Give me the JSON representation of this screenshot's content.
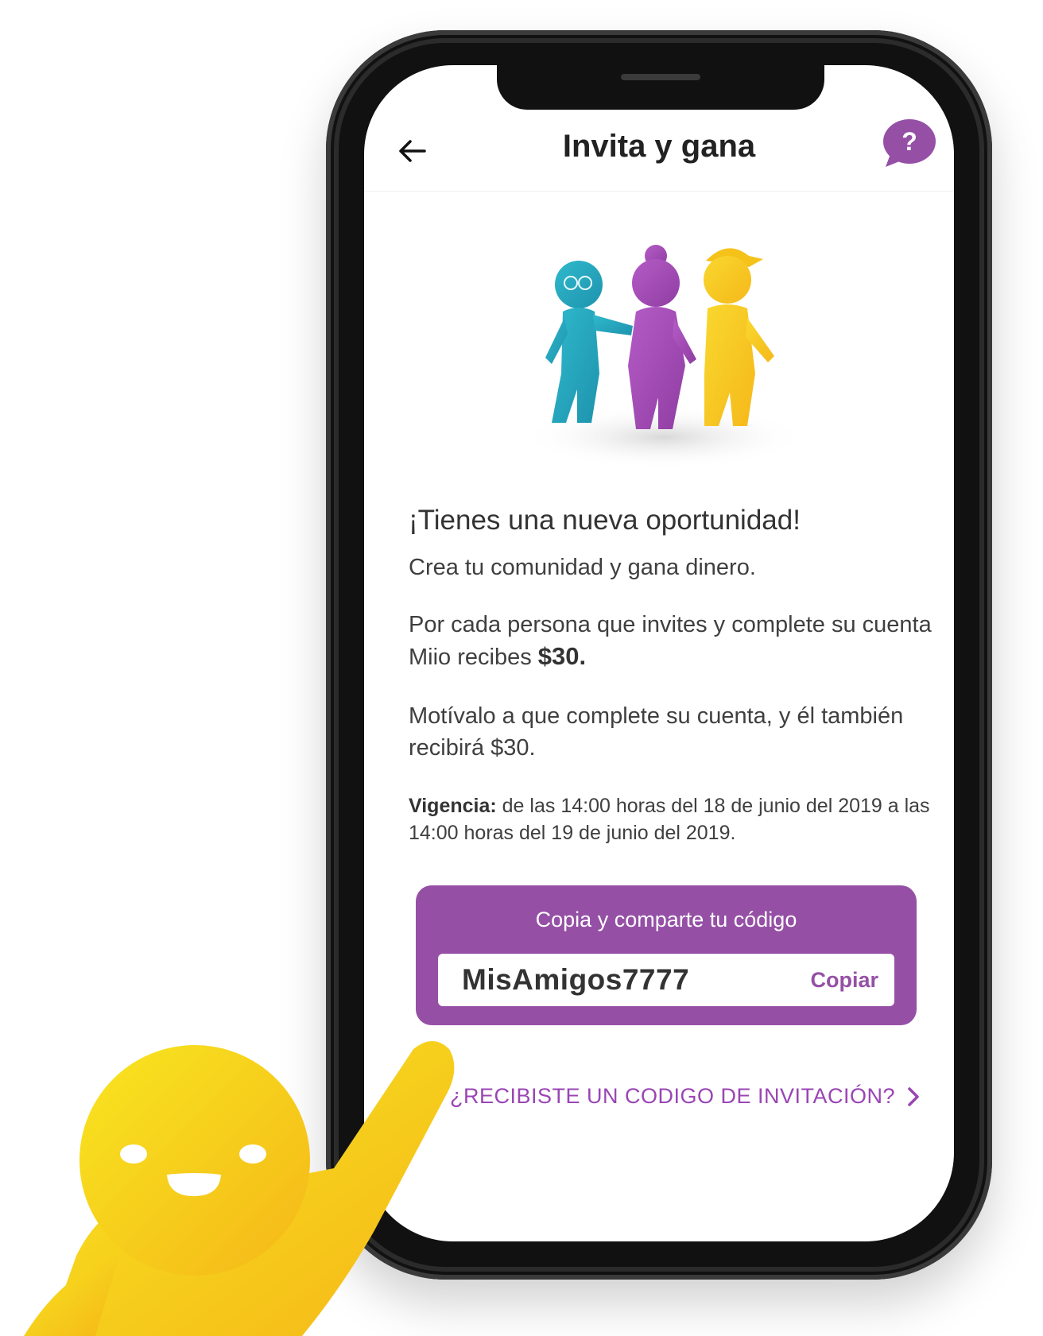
{
  "header": {
    "title": "Invita y gana",
    "help_symbol": "?",
    "back_icon": "arrow-left-icon",
    "help_icon": "chat-help-icon"
  },
  "content": {
    "headline": "¡Tienes una nueva oportunidad!",
    "intro": "Crea tu comunidad y gana dinero.",
    "reward_line_prefix": "Por cada persona que invites y complete su cuenta Miio recibes",
    "reward_amount": "$30.",
    "motivation": "Motívalo a que complete su cuenta, y él también recibirá $30.",
    "validity_label": "Vigencia:",
    "validity_text": "de las 14:00 horas del 18 de junio del 2019 a las 14:00 horas del 19 de junio del 2019."
  },
  "code_card": {
    "title": "Copia y comparte tu código",
    "code": "MisAmigos7777",
    "copy_label": "Copiar"
  },
  "invite_link": {
    "label": "¿RECIBISTE UN CODIGO DE INVITACIÓN?",
    "icon": "chevron-right-icon"
  },
  "colors": {
    "accent": "#9550a6",
    "link": "#9a45b4",
    "teal": "#2ab3c9",
    "purple": "#a34fb5",
    "yellow": "#f7cc1c"
  }
}
